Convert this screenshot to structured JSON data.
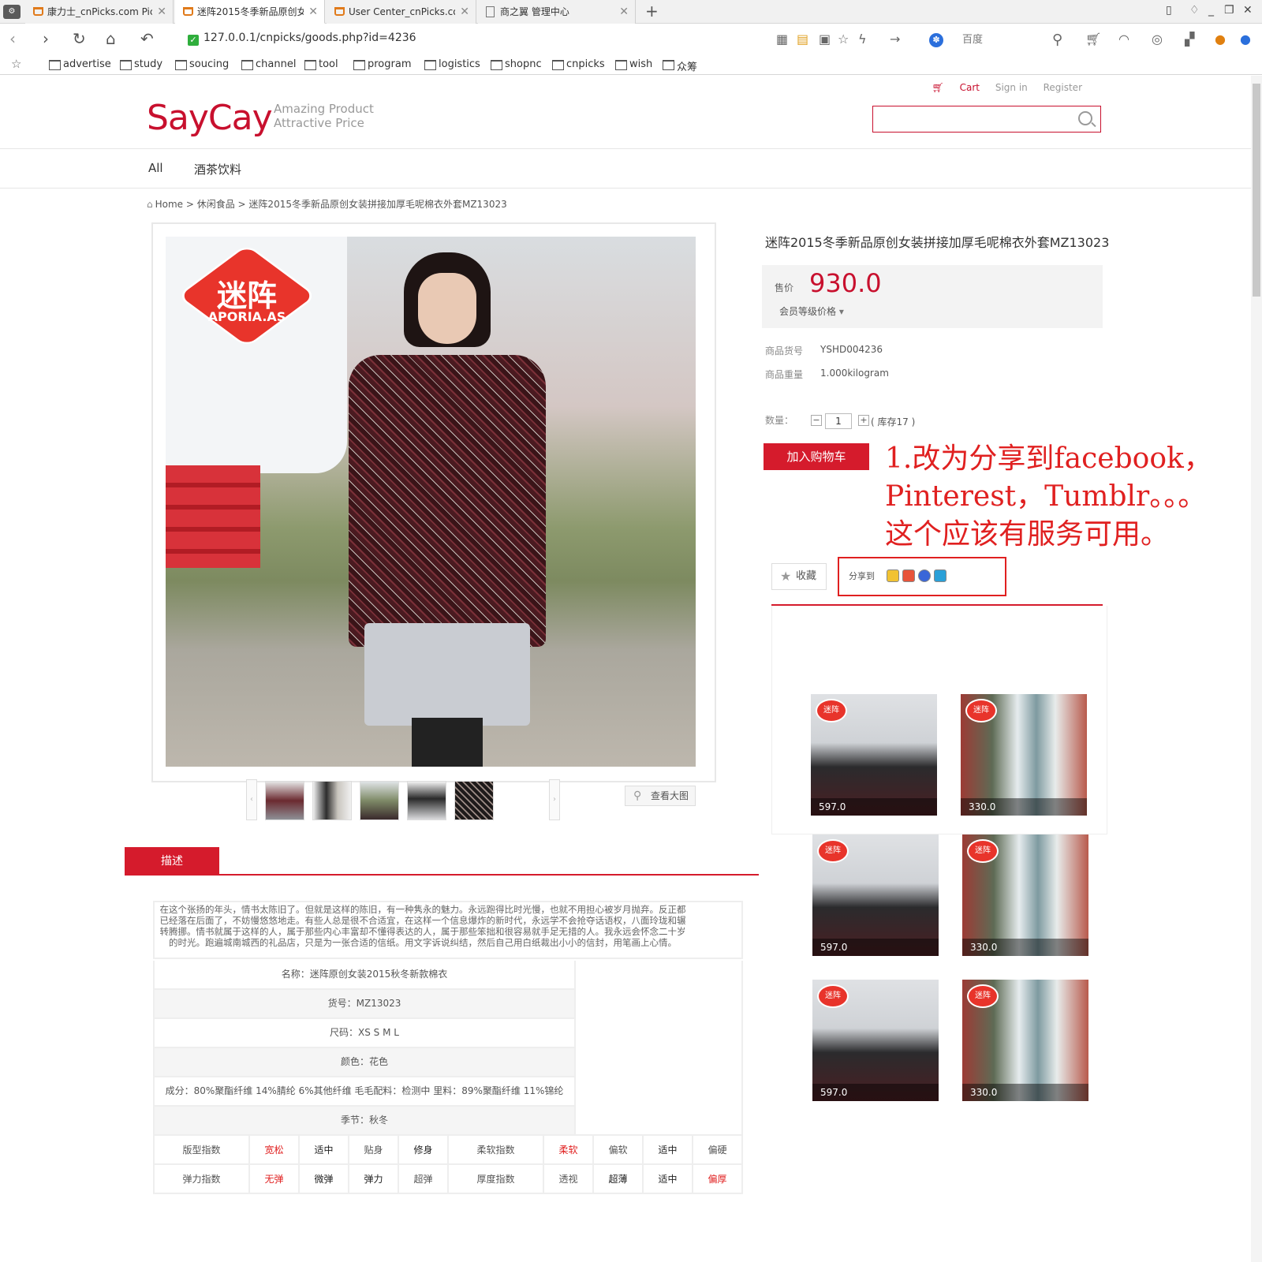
{
  "browser": {
    "tabs": [
      {
        "title": "康力士_cnPicks.com Pic",
        "icon": "cart-icon"
      },
      {
        "title": "迷阵2015冬季新品原创女",
        "icon": "cart-icon"
      },
      {
        "title": "User Center_cnPicks.co",
        "icon": "cart-icon"
      },
      {
        "title": "商之翼 管理中心",
        "icon": "document-icon"
      }
    ],
    "url": "127.0.0.1/cnpicks/goods.php?id=4236",
    "search_engine": "百度",
    "bookmarks": [
      "advertise",
      "study",
      "soucing",
      "channel",
      "tool",
      "program",
      "logistics",
      "shopnc",
      "cnpicks",
      "wish",
      "众筹"
    ]
  },
  "header": {
    "cart_label": "Cart",
    "signin_label": "Sign in",
    "register_label": "Register",
    "logo": "SayCay",
    "slogan_line1": "Amazing Product",
    "slogan_line2": "Attractive Price",
    "search_value": ""
  },
  "nav": {
    "items": [
      "All",
      "酒茶饮料"
    ]
  },
  "breadcrumb": "Home > 休闲食品 > 迷阵2015冬季新品原创女装拼接加厚毛呢棉衣外套MZ13023",
  "gallery": {
    "brand_cn": "迷阵",
    "brand_en": "APORIA.AS",
    "view_large_label": "查看大图"
  },
  "product": {
    "title": "迷阵2015冬季新品原创女装拼接加厚毛呢棉衣外套MZ13023",
    "price_label": "售价",
    "price": "930.0",
    "member_price_label": "会员等级价格",
    "sku_label": "商品货号",
    "sku": "YSHD004236",
    "weight_label": "商品重量",
    "weight": "1.000kilogram",
    "qty_label": "数量：",
    "qty_value": "1",
    "minus": "−",
    "plus": "+",
    "stock_text": "( 库存17 )",
    "add_to_cart": "加入购物车",
    "favorite_label": "收藏",
    "share_label": "分享到"
  },
  "annotation": "1.改为分享到facebook，\nPinterest，Tumblr。。。\n这个应该有服务可用。",
  "recommendations": [
    {
      "price": "597.0",
      "style": "dark"
    },
    {
      "price": "330.0",
      "style": "light"
    },
    {
      "price": "597.0",
      "style": "dark"
    },
    {
      "price": "330.0",
      "style": "light"
    },
    {
      "price": "597.0",
      "style": "dark"
    },
    {
      "price": "330.0",
      "style": "light"
    }
  ],
  "description": {
    "tab_label": "描述",
    "paragraph": "在这个张扬的年头，情书太陈旧了。但就是这样的陈旧，有一种隽永的魅力。永远跑得比时光慢，也就不用担心被岁月抛弃。反正都已经落在后面了，不妨慢悠悠地走。有些人总是很不合适宜，在这样一个信息爆炸的新时代，永远学不会抢夺话语权，八面玲珑和辗转腾挪。情书就属于这样的人，属于那些内心丰富却不懂得表达的人，属于那些笨拙和很容易就手足无措的人。我永远会怀念二十岁的时光。跑遍城南城西的礼品店，只是为一张合适的信纸。用文字诉说纠结，然后自己用白纸裁出小小的信封，用笔画上心情。",
    "specs": [
      "名称：迷阵原创女装2015秋冬新款棉衣",
      "货号：MZ13023",
      "尺码：XS S M L",
      "颜色：花色",
      "成分：80%聚酯纤维 14%腈纶  6%其他纤维 毛毛配料：检测中 里料：89%聚酯纤维  11%锦纶",
      "季节：秋冬"
    ],
    "grid": [
      [
        {
          "t": "版型指数",
          "c": ""
        },
        {
          "t": "宽松",
          "c": "red"
        },
        {
          "t": "适中",
          "c": "dark"
        },
        {
          "t": "贴身",
          "c": ""
        },
        {
          "t": "修身",
          "c": "dark"
        },
        {
          "t": "柔软指数",
          "c": ""
        },
        {
          "t": "柔软",
          "c": "red"
        },
        {
          "t": "偏软",
          "c": ""
        },
        {
          "t": "适中",
          "c": "dark"
        },
        {
          "t": "偏硬",
          "c": ""
        }
      ],
      [
        {
          "t": "弹力指数",
          "c": ""
        },
        {
          "t": "无弹",
          "c": "red"
        },
        {
          "t": "微弹",
          "c": "dark"
        },
        {
          "t": "弹力",
          "c": "dark"
        },
        {
          "t": "超弹",
          "c": ""
        },
        {
          "t": "厚度指数",
          "c": ""
        },
        {
          "t": "透视",
          "c": ""
        },
        {
          "t": "超薄",
          "c": "dark"
        },
        {
          "t": "适中",
          "c": "dark"
        },
        {
          "t": "偏厚",
          "c": "red"
        }
      ]
    ]
  },
  "colors": {
    "accent": "#d51b2c",
    "annotation": "#e02020"
  }
}
